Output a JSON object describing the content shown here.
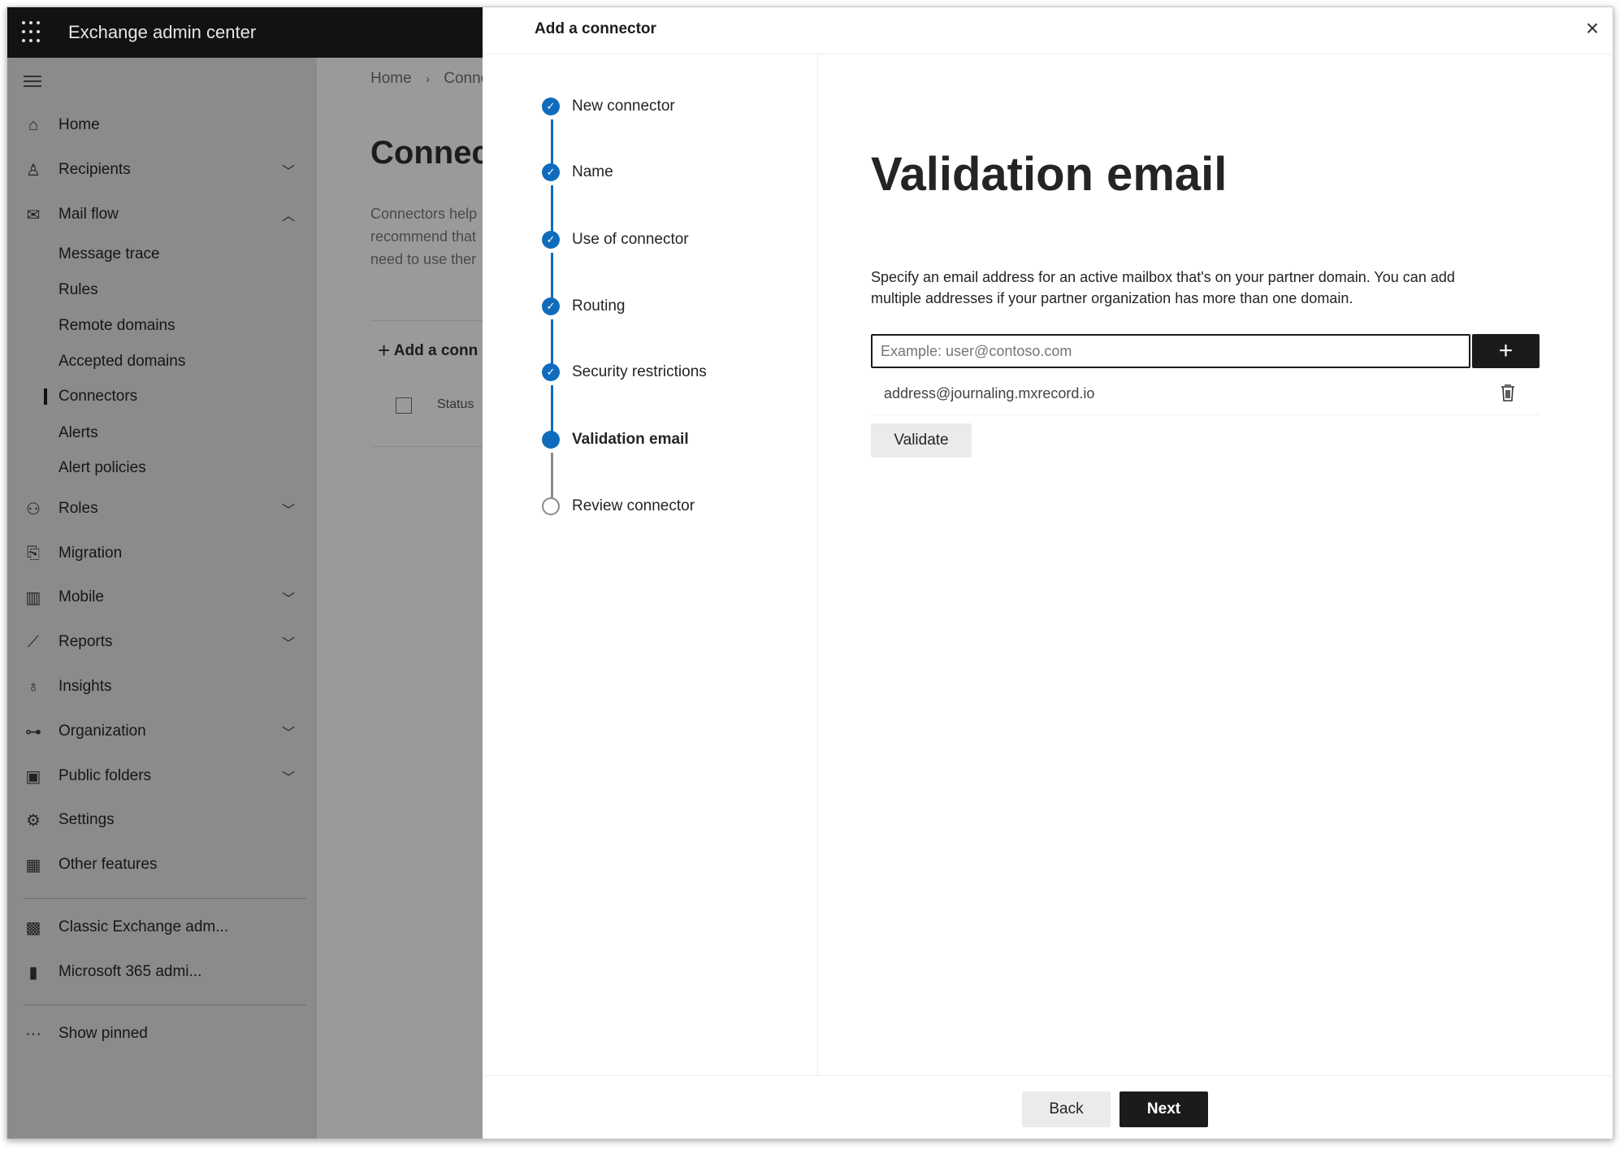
{
  "app": {
    "title": "Exchange admin center"
  },
  "sidebar": {
    "items": [
      {
        "label": "Home",
        "icon": "home-icon"
      },
      {
        "label": "Recipients",
        "icon": "person-icon",
        "chevron": "down"
      },
      {
        "label": "Mail flow",
        "icon": "mail-icon",
        "chevron": "up"
      },
      {
        "label": "Message trace"
      },
      {
        "label": "Rules"
      },
      {
        "label": "Remote domains"
      },
      {
        "label": "Accepted domains"
      },
      {
        "label": "Connectors",
        "active": true
      },
      {
        "label": "Alerts"
      },
      {
        "label": "Alert policies"
      },
      {
        "label": "Roles",
        "icon": "roles-icon",
        "chevron": "down"
      },
      {
        "label": "Migration",
        "icon": "migration-icon"
      },
      {
        "label": "Mobile",
        "icon": "mobile-icon",
        "chevron": "down"
      },
      {
        "label": "Reports",
        "icon": "chart-icon",
        "chevron": "down"
      },
      {
        "label": "Insights",
        "icon": "lightbulb-icon"
      },
      {
        "label": "Organization",
        "icon": "org-icon",
        "chevron": "down"
      },
      {
        "label": "Public folders",
        "icon": "folder-icon",
        "chevron": "down"
      },
      {
        "label": "Settings",
        "icon": "gear-icon"
      },
      {
        "label": "Other features",
        "icon": "table-icon"
      },
      {
        "label": "Classic Exchange adm...",
        "icon": "exchange-icon"
      },
      {
        "label": "Microsoft 365 admi...",
        "icon": "office-icon"
      },
      {
        "label": "Show pinned",
        "icon": "more-icon"
      }
    ]
  },
  "background": {
    "breadcrumb": [
      "Home",
      "Conne"
    ],
    "title": "Connec",
    "description": [
      "Connectors help",
      "recommend that",
      "need to use ther"
    ],
    "add_button": "Add a conn",
    "column_status": "Status"
  },
  "panel": {
    "title": "Add a connector",
    "steps": [
      {
        "label": "New connector",
        "state": "done"
      },
      {
        "label": "Name",
        "state": "done"
      },
      {
        "label": "Use of connector",
        "state": "done"
      },
      {
        "label": "Routing",
        "state": "done"
      },
      {
        "label": "Security restrictions",
        "state": "done"
      },
      {
        "label": "Validation email",
        "state": "current"
      },
      {
        "label": "Review connector",
        "state": "pending"
      }
    ],
    "heading": "Validation email",
    "description_1": "Specify an email address for an active mailbox that's on your partner domain. You can add",
    "description_2": "multiple addresses if your partner organization has more than one domain.",
    "email_input": {
      "placeholder": "Example: user@contoso.com",
      "value": ""
    },
    "addresses": [
      "address@journaling.mxrecord.io"
    ],
    "validate_label": "Validate",
    "back_label": "Back",
    "next_label": "Next"
  },
  "colors": {
    "accent": "#0f6cbd",
    "topbar": "#121212",
    "primary_button": "#1b1b1b"
  }
}
